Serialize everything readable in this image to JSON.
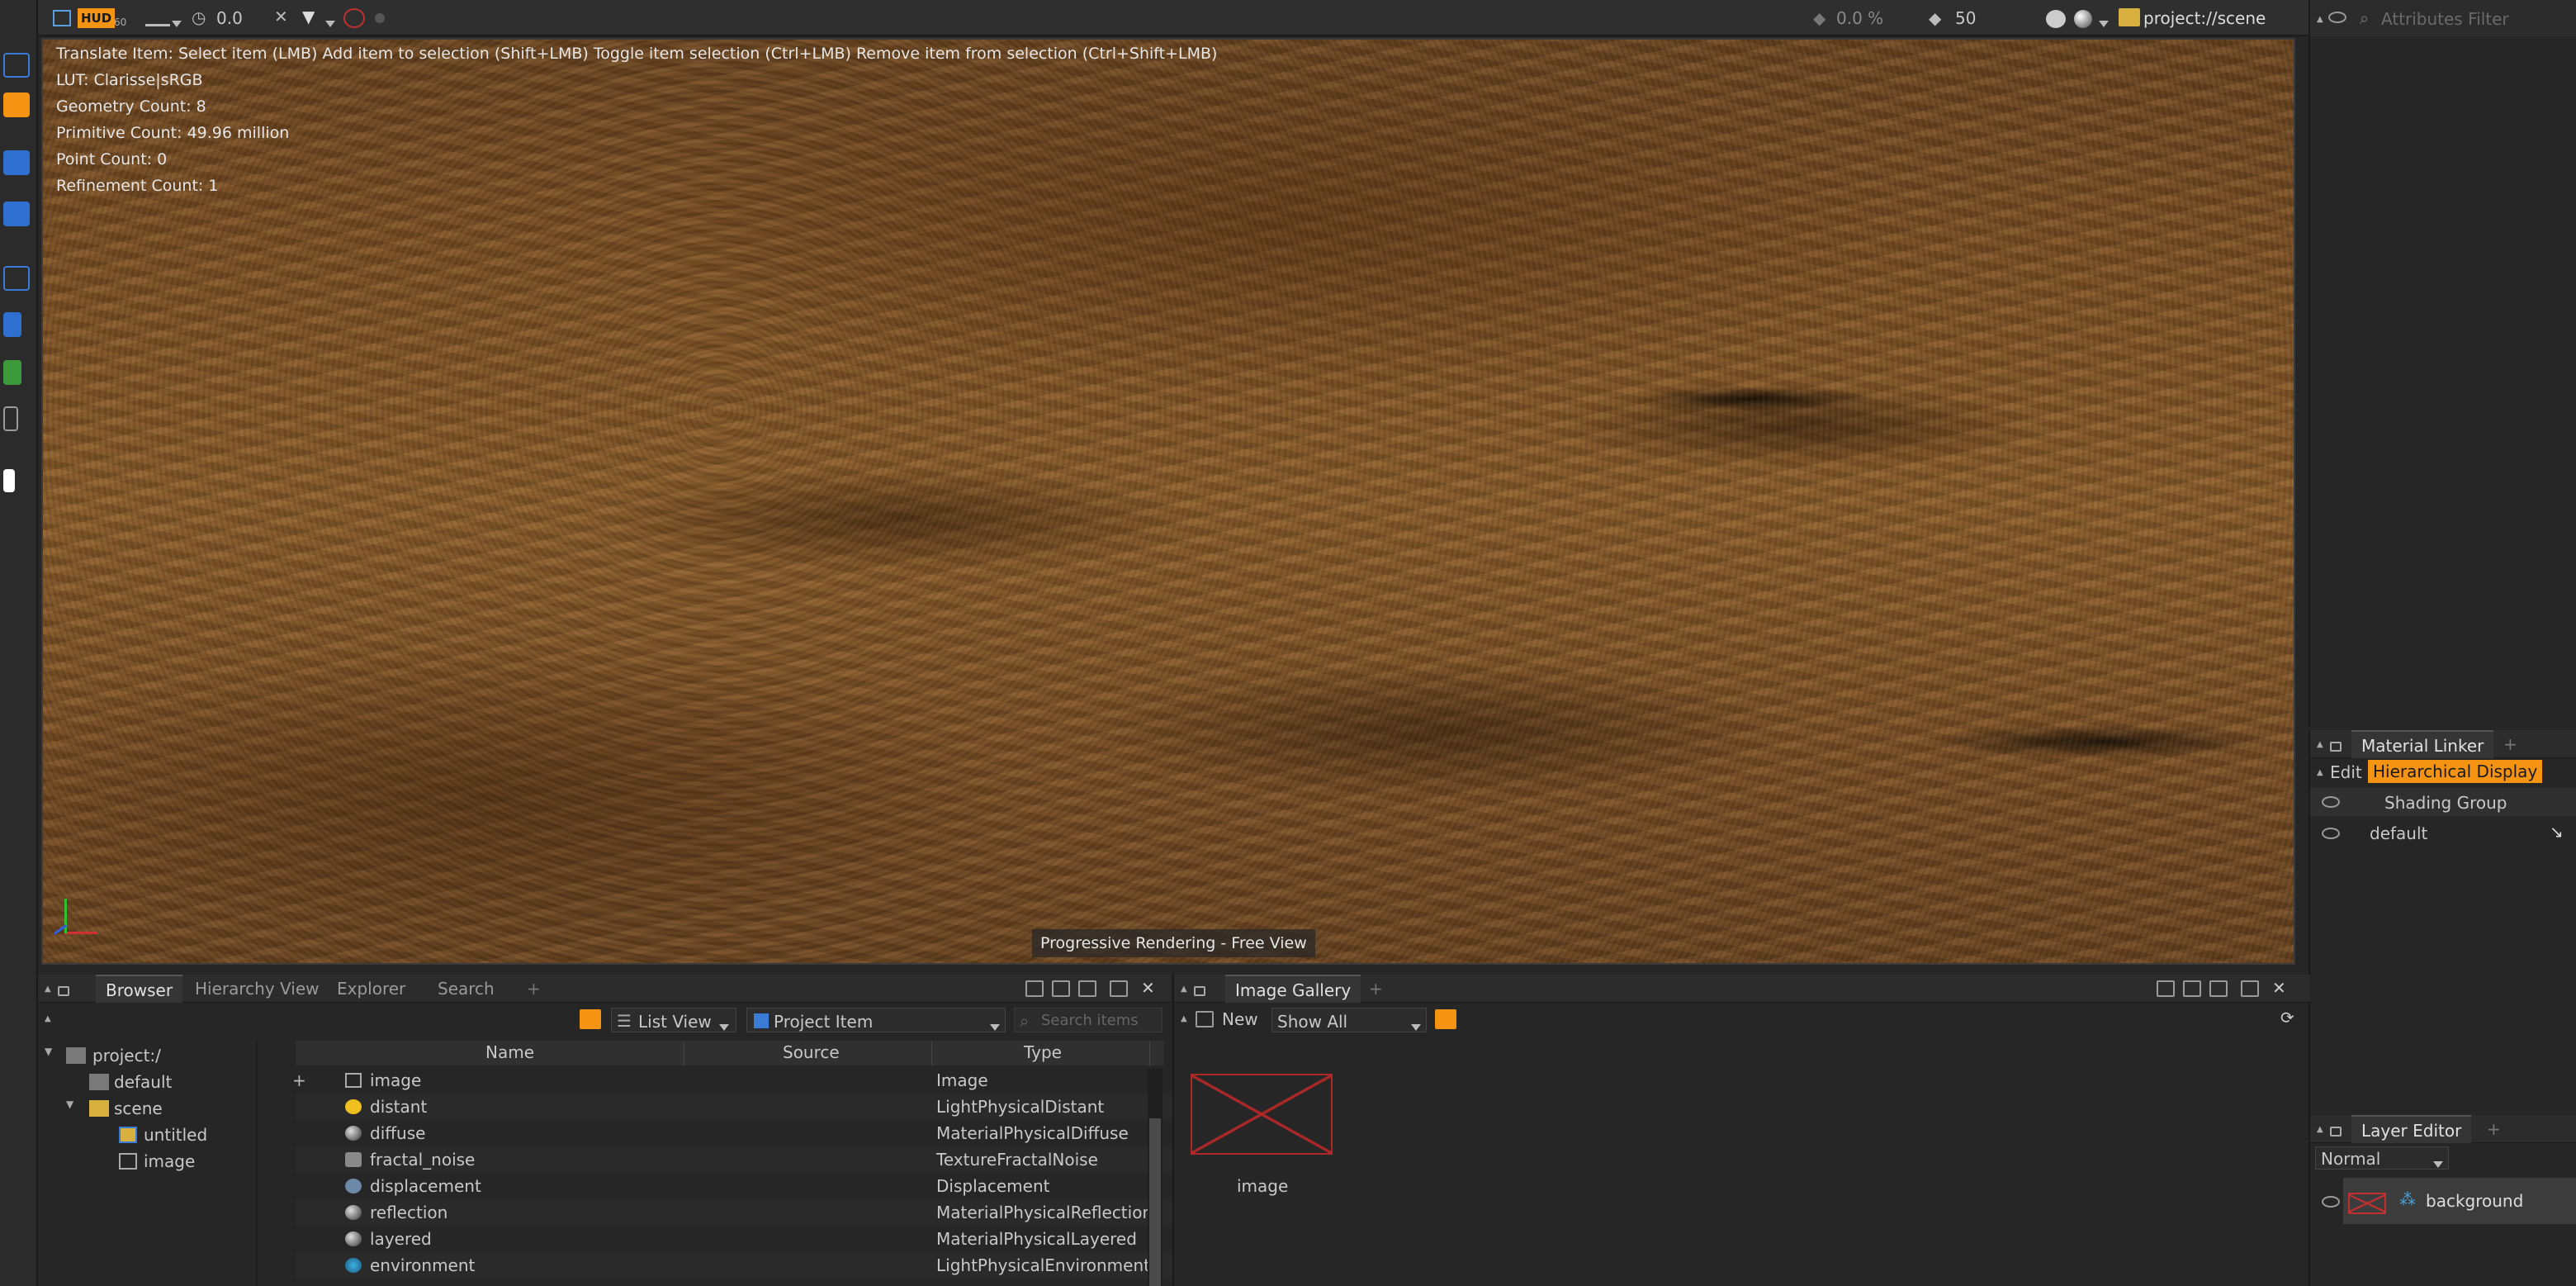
{
  "toolbar": {
    "hud_label": "HUD",
    "hud_sub": "60",
    "time_value": "0.0",
    "percent_value": "0.0 %",
    "samples_value": "50",
    "project_path": "project://scene"
  },
  "viewport": {
    "hud_lines": [
      "Translate Item: Select item (LMB)  Add item to selection (Shift+LMB)  Toggle item selection (Ctrl+LMB)  Remove item from selection (Ctrl+Shift+LMB)",
      "LUT: Clarisse|sRGB",
      "Geometry Count: 8",
      "Primitive Count: 49.96 million",
      "Point Count: 0",
      "Refinement Count: 1"
    ],
    "status": "Progressive Rendering - Free View"
  },
  "attributes": {
    "filter_placeholder": "Attributes Filter"
  },
  "browser": {
    "tabs": [
      "Browser",
      "Hierarchy View",
      "Explorer",
      "Search"
    ],
    "add_tab": "+",
    "view_mode": "List View",
    "item_type": "Project Item",
    "search_placeholder": "Search items",
    "tree": [
      {
        "label": "project:/",
        "depth": 0
      },
      {
        "label": "default",
        "depth": 1
      },
      {
        "label": "scene",
        "depth": 1
      },
      {
        "label": "untitled",
        "depth": 2
      },
      {
        "label": "image",
        "depth": 2
      }
    ],
    "columns": [
      "Name",
      "Source",
      "Type"
    ],
    "rows": [
      {
        "name": "image",
        "type": "Image",
        "icon": "image-icon"
      },
      {
        "name": "distant",
        "type": "LightPhysicalDistant",
        "icon": "sun-icon"
      },
      {
        "name": "diffuse",
        "type": "MaterialPhysicalDiffuse",
        "icon": "sphere-icon"
      },
      {
        "name": "fractal_noise",
        "type": "TextureFractalNoise",
        "icon": "texture-icon"
      },
      {
        "name": "displacement",
        "type": "Displacement",
        "icon": "displacement-icon"
      },
      {
        "name": "reflection",
        "type": "MaterialPhysicalReflection",
        "icon": "sphere-icon"
      },
      {
        "name": "layered",
        "type": "MaterialPhysicalLayered",
        "icon": "sphere-icon"
      },
      {
        "name": "environment",
        "type": "LightPhysicalEnvironment",
        "icon": "environment-icon"
      }
    ]
  },
  "gallery": {
    "tab": "Image Gallery",
    "add_tab": "+",
    "new_label": "New",
    "filter": "Show All",
    "thumb_label": "image"
  },
  "material_linker": {
    "tab": "Material Linker",
    "add_tab": "+",
    "edit_label": "Edit",
    "display_label": "Hierarchical Display",
    "column": "Shading Group",
    "rows": [
      "default"
    ]
  },
  "layer_editor": {
    "tab": "Layer Editor",
    "add_tab": "+",
    "blend_mode": "Normal",
    "layers": [
      "background"
    ]
  },
  "colors": {
    "accent": "#f59313",
    "bg": "#262626",
    "terrain": "#7c5024"
  }
}
